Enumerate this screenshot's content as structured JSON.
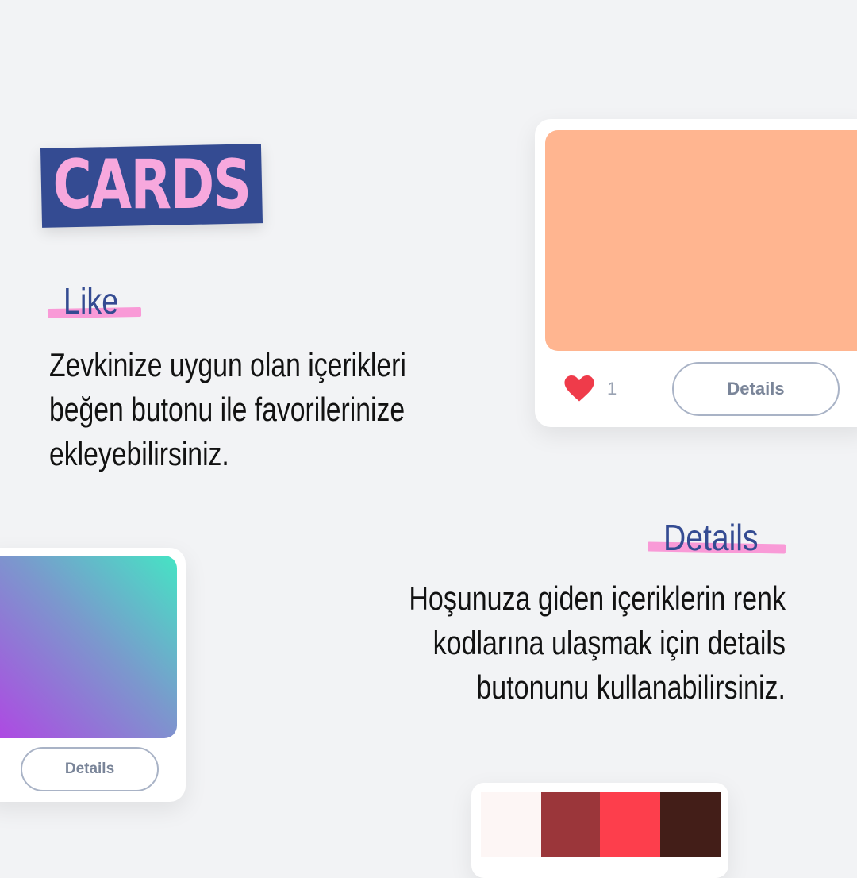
{
  "badge": {
    "title": "CARDS"
  },
  "like_section": {
    "heading": "Like",
    "lines": [
      "Zevkinize uygun olan içerikleri",
      "beğen butonu ile favorilerinize",
      "ekleyebilirsiniz."
    ]
  },
  "details_section": {
    "heading": "Details",
    "lines": [
      "Hoşunuza giden içeriklerin renk",
      "kodlarına ulaşmak için details",
      "butonunu kullanabilirsiniz."
    ]
  },
  "card_top": {
    "swatch_color": "#ffb590",
    "like_count": "1",
    "details_label": "Details"
  },
  "card_left": {
    "gradient_colors": [
      "#b046e3",
      "#45e4c4"
    ],
    "details_label": "Details"
  },
  "card_bottom": {
    "palette": [
      "#fdf6f5",
      "#9b363a",
      "#fd3e4c",
      "#431e18"
    ]
  },
  "colors": {
    "background": "#f2f3f5",
    "accent_blue": "#344b92",
    "accent_pink": "#f99ad7",
    "heart": "#ef3b4a"
  }
}
